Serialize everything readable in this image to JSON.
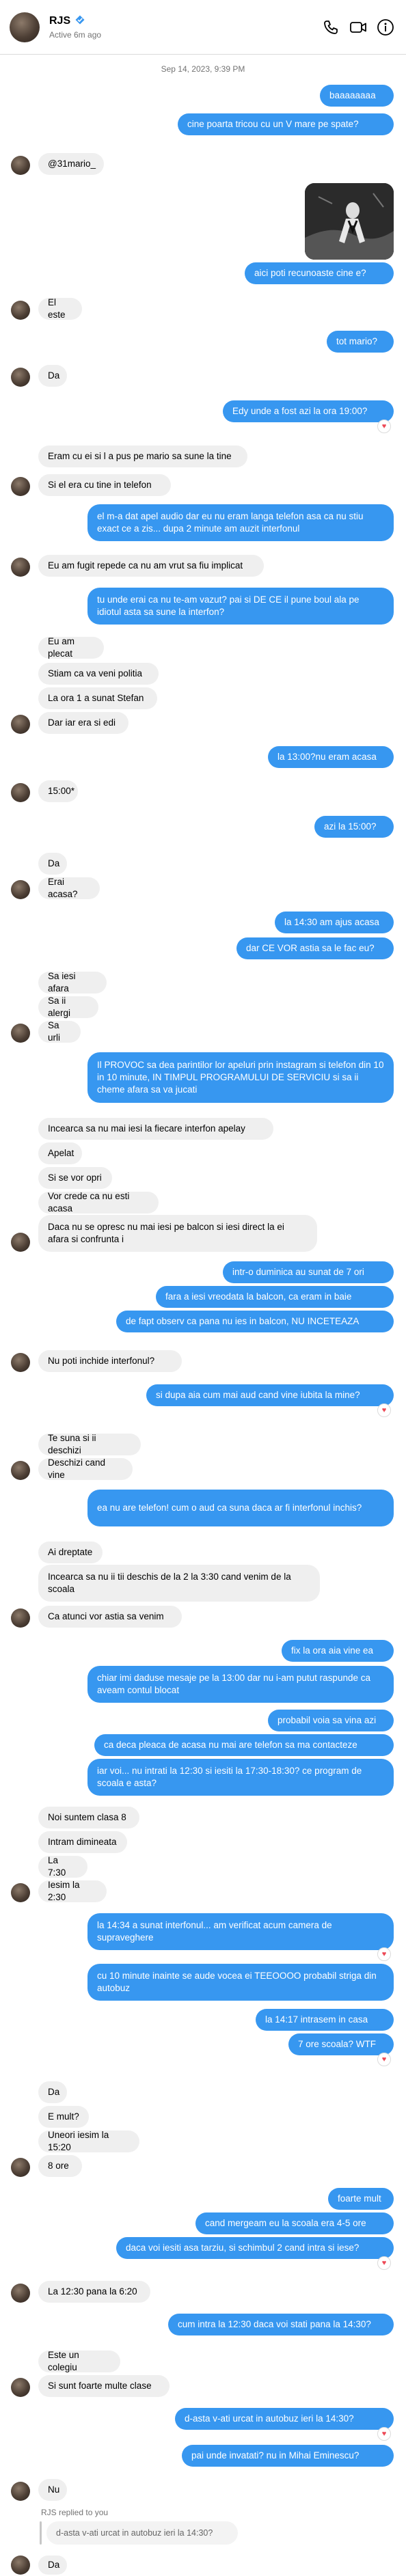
{
  "header": {
    "name": "RJS",
    "verified_icon": "verified-badge-icon",
    "status": "Active 6m ago",
    "icons": [
      "phone-icon",
      "video-icon",
      "info-icon"
    ]
  },
  "timestamp": "Sep 14, 2023, 9:39 PM",
  "messages": [
    {
      "text": "baaaaaaaa"
    },
    {
      "text": "cine poarta tricou cu un V mare pe spate?"
    },
    {
      "text": "@31mario_"
    },
    {
      "photo_icon": "photo-icon"
    },
    {
      "text": "aici poti recunoaste cine e?"
    },
    {
      "text": "El este"
    },
    {
      "text": "tot mario?"
    },
    {
      "text": "Da"
    },
    {
      "text": "Edy unde a fost azi la ora 19:00?"
    },
    {
      "text": "Eram cu ei si l a pus pe mario sa sune la tine"
    },
    {
      "text": "Si el era cu tine in telefon"
    },
    {
      "text": "el m-a dat apel audio dar eu nu eram langa telefon asa ca nu stiu exact ce a zis... dupa 2 minute am auzit interfonul"
    },
    {
      "text": "Eu am fugit repede ca nu am vrut sa fiu implicat"
    },
    {
      "text": "tu unde erai ca nu te-am vazut? pai si DE CE il pune boul ala pe idiotul asta sa sune la interfon?"
    },
    {
      "text": "Eu am plecat"
    },
    {
      "text": "Stiam ca va veni politia"
    },
    {
      "text": "La ora 1 a sunat Stefan"
    },
    {
      "text": "Dar iar era si edi"
    },
    {
      "text": "la 13:00?nu eram acasa"
    },
    {
      "text": "15:00*"
    },
    {
      "text": "azi la 15:00?"
    },
    {
      "text": "Da"
    },
    {
      "text": "Erai acasa?"
    },
    {
      "text": "la 14:30 am ajus acasa"
    },
    {
      "text": "dar CE VOR astia sa le fac eu?"
    },
    {
      "text": "Sa iesi afara"
    },
    {
      "text": "Sa ii alergi"
    },
    {
      "text": "Sa urli"
    },
    {
      "text": "Il PROVOC sa dea parintilor lor apeluri prin instagram si telefon din 10 in 10 minute, IN TIMPUL PROGRAMULUI DE SERVICIU si sa ii cheme afara sa va jucati"
    },
    {
      "text": "Incearca sa nu mai iesi la fiecare interfon apelay"
    },
    {
      "text": "Apelat"
    },
    {
      "text": "Si se vor opri"
    },
    {
      "text": "Vor crede ca nu esti acasa"
    },
    {
      "text": "Daca nu se opresc nu mai iesi pe balcon si iesi direct la ei afara si confrunta i"
    },
    {
      "text": "intr-o duminica au sunat de 7 ori"
    },
    {
      "text": "fara a iesi vreodata la balcon, ca eram in baie"
    },
    {
      "text": "de fapt observ ca pana nu ies in balcon, NU INCETEAZA"
    },
    {
      "text": "Nu poti inchide interfonul?"
    },
    {
      "text": "si dupa aia cum mai aud cand vine iubita la mine?"
    },
    {
      "text": "Te suna si ii deschizi"
    },
    {
      "text": "Deschizi cand vine"
    },
    {
      "text": "ea nu are telefon! cum o aud ca suna daca ar fi interfonul inchis?"
    },
    {
      "text": "Ai dreptate"
    },
    {
      "text": "Incearca sa nu ii tii deschis de la 2 la 3:30 cand venim de la scoala"
    },
    {
      "text": "Ca atunci vor astia sa venim"
    },
    {
      "text": "fix la ora aia vine ea"
    },
    {
      "text": "chiar imi daduse mesaje pe la 13:00 dar nu i-am putut raspunde ca aveam contul blocat"
    },
    {
      "text": "probabil voia sa vina azi"
    },
    {
      "text": "ca deca pleaca de acasa nu mai are telefon sa ma contacteze"
    },
    {
      "text": "iar voi... nu intrati la 12:30 si iesiti la 17:30-18:30? ce program de scoala e asta?"
    },
    {
      "text": "Noi suntem clasa 8"
    },
    {
      "text": "Intram dimineata"
    },
    {
      "text": "La 7:30"
    },
    {
      "text": "Iesim la 2:30"
    },
    {
      "text": "la 14:34 a sunat interfonul... am verificat acum camera de supraveghere"
    },
    {
      "text": "cu 10 minute inainte se aude vocea ei TEEOOOO probabil striga din autobuz"
    },
    {
      "text": "la 14:17 intrasem in casa"
    },
    {
      "text": "7 ore scoala? WTF"
    },
    {
      "text": "Da"
    },
    {
      "text": "E mult?"
    },
    {
      "text": "Uneori iesim la 15:20"
    },
    {
      "text": "8 ore"
    },
    {
      "text": "foarte mult"
    },
    {
      "text": "cand mergeam eu la scoala era 4-5 ore"
    },
    {
      "text": "daca voi iesiti asa tarziu, si schimbul 2 cand intra si iese?"
    },
    {
      "text": "La 12:30 pana la 6:20"
    },
    {
      "text": "cum intra la 12:30 daca voi stati pana la 14:30?"
    },
    {
      "text": "Este un colegiu"
    },
    {
      "text": "Si sunt foarte multe clase"
    },
    {
      "text": "d-asta v-ati urcat in autobuz ieri la 14:30?"
    },
    {
      "text": "pai unde invatati? nu in Mihai Eminescu?"
    },
    {
      "text": "Nu"
    },
    {
      "text": "Da"
    }
  ],
  "reply": {
    "label": "RJS replied to you",
    "quote": "d-asta v-ati urcat in autobuz ieri la 14:30?"
  },
  "reaction_icon": "heart-reaction-icon",
  "reaction_glyph": "♥",
  "colors": {
    "outgoing": "#3797f0",
    "incoming": "#efefef",
    "accent_heart": "#ed4956"
  }
}
